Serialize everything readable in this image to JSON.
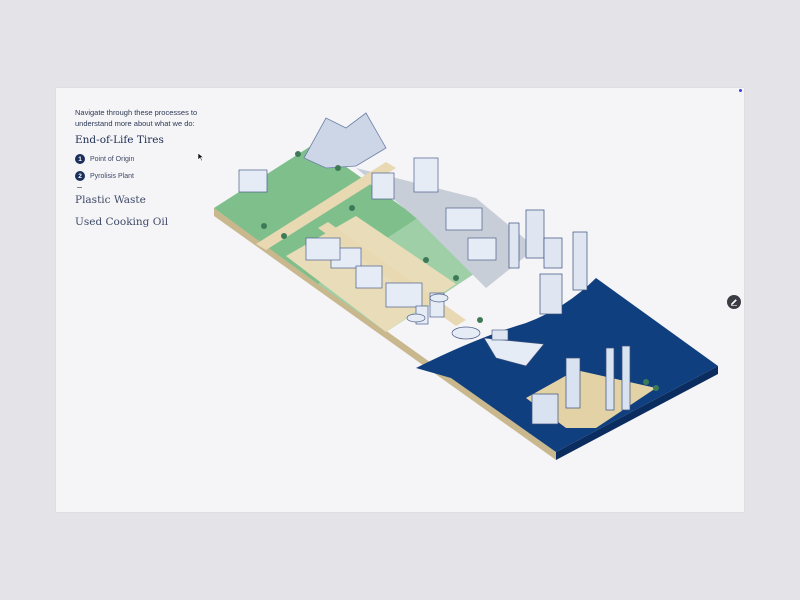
{
  "intro_text": "Navigate through these processes to\nunderstand more about what we do:",
  "categories": {
    "tires": "End-of-Life Tires",
    "plastic": "Plastic Waste",
    "oil": "Used Cooking Oil"
  },
  "steps": [
    {
      "number": "1",
      "label": "Point of Origin"
    },
    {
      "number": "2",
      "label": "Pyrolisis Plant"
    }
  ],
  "colors": {
    "accent": "#1b2f5c",
    "grass": "#7fbf8c",
    "road": "#e8d9b3",
    "water": "#0f3f7e",
    "building": "#e6ecf6"
  },
  "icons": {
    "edit": "pen-icon",
    "cursor": "mouse-pointer-icon"
  }
}
